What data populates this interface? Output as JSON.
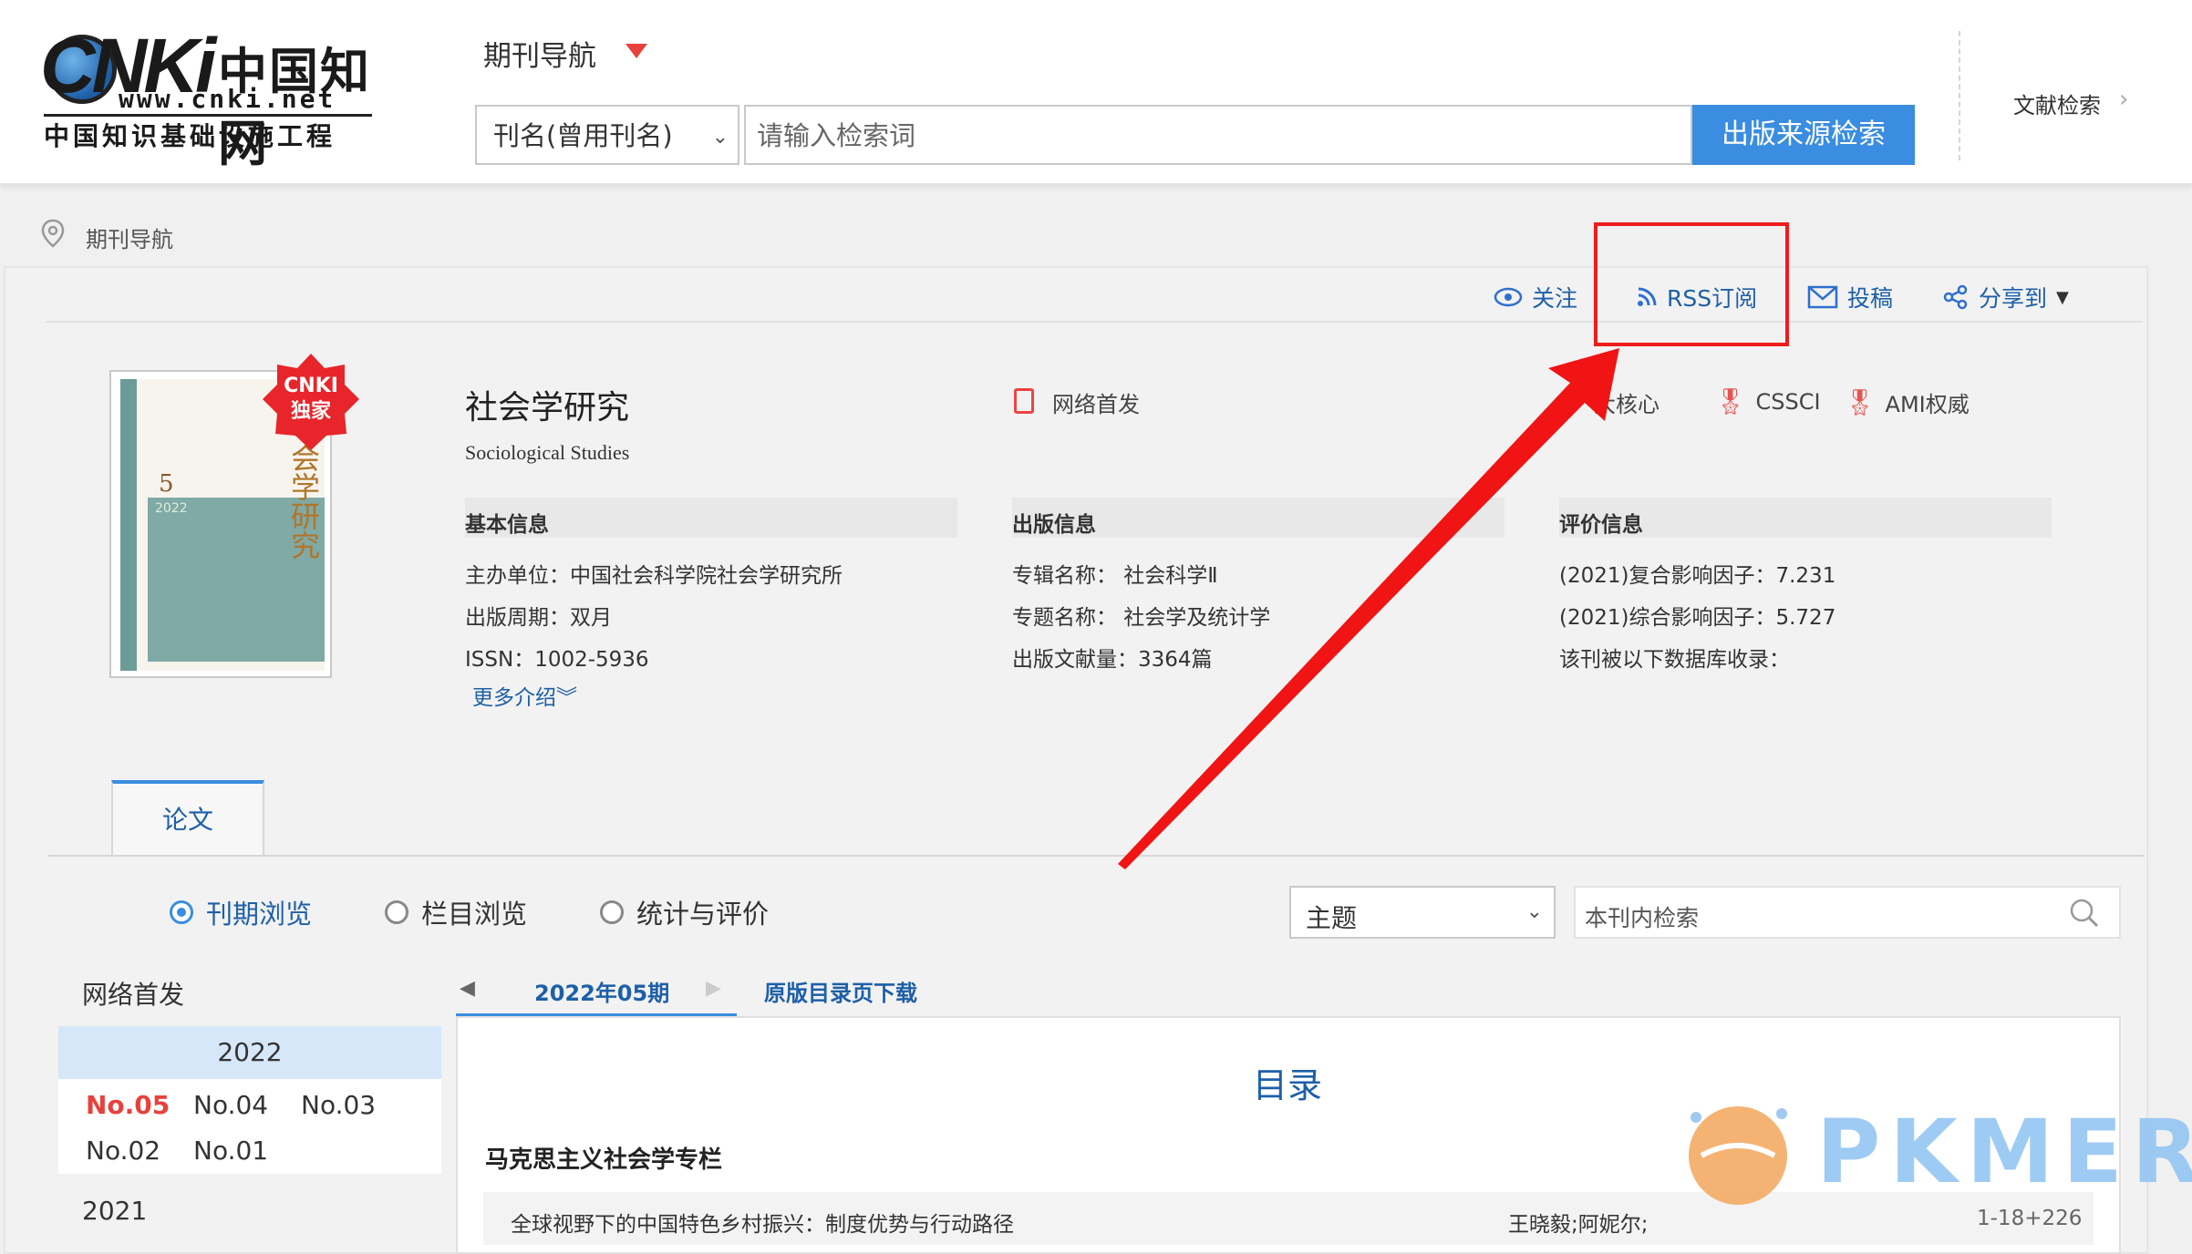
{
  "header": {
    "logo": {
      "cnki": "CNKi",
      "cn": "中国知网",
      "url": "www.cnki.net",
      "sub": "中国知识基础设施工程"
    },
    "nav_title": "期刊导航",
    "search_field": "刊名(曾用刊名)",
    "search_placeholder": "请输入检索词",
    "search_button": "出版来源检索",
    "doc_search": "文献检索"
  },
  "breadcrumb": {
    "text": "期刊导航"
  },
  "actions": {
    "follow": "关注",
    "rss": "RSS订阅",
    "submit": "投稿",
    "share": "分享到"
  },
  "cover": {
    "badge_line1": "CNKI",
    "badge_line2": "独家",
    "issue_no": "5",
    "year": "2022",
    "title": "会学研究"
  },
  "journal": {
    "title": "社会学研究",
    "title_en": "Sociological Studies",
    "first_pub": "网络首发",
    "tags": [
      "大核心",
      "CSSCI",
      "AMI权威"
    ]
  },
  "info": {
    "basic": {
      "head": "基本信息",
      "rows": [
        "主办单位：中国社会科学院社会学研究所",
        "出版周期：双月",
        "ISSN：1002-5936"
      ],
      "more": "更多介绍"
    },
    "publish": {
      "head": "出版信息",
      "rows": [
        "专辑名称：  社会科学Ⅱ",
        "专题名称：  社会学及统计学",
        "出版文献量：3364篇"
      ]
    },
    "eval": {
      "head": "评价信息",
      "rows": [
        "(2021)复合影响因子：7.231",
        "(2021)综合影响因子：5.727",
        "该刊被以下数据库收录："
      ]
    }
  },
  "tab": {
    "label": "论文"
  },
  "browse": {
    "options": [
      "刊期浏览",
      "栏目浏览",
      "统计与评价"
    ],
    "field": "主题",
    "in_search_placeholder": "本刊内检索"
  },
  "years": {
    "net_first": "网络首发",
    "current_year": "2022",
    "issues": [
      "No.05",
      "No.04",
      "No.03",
      "No.02",
      "No.01"
    ],
    "prev_year": "2021"
  },
  "content": {
    "issue_tab": "2022年05期",
    "download": "原版目录页下载",
    "toc_title": "目录",
    "section": "马克思主义社会学专栏",
    "articles": [
      {
        "title": "全球视野下的中国特色乡村振兴：制度优势与行动路径",
        "authors": "王晓毅;阿妮尔;",
        "pages": "1-18+226"
      }
    ]
  },
  "watermark": "PKMER",
  "colors": {
    "accent": "#3a8de0",
    "link": "#1d5fa8",
    "highlight": "#ee1c1c"
  }
}
